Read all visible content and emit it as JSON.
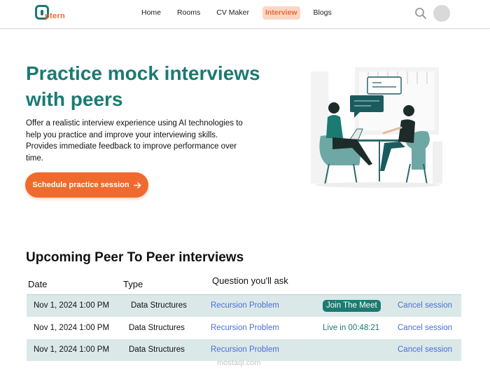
{
  "brand": {
    "name": "ptern"
  },
  "nav": {
    "items": [
      {
        "label": "Home",
        "active": false
      },
      {
        "label": "Rooms",
        "active": false
      },
      {
        "label": "CV Maker",
        "active": false
      },
      {
        "label": "Interview",
        "active": true
      },
      {
        "label": "Blogs",
        "active": false
      }
    ],
    "search_icon": "search-icon",
    "avatar": "avatar"
  },
  "hero": {
    "title": "Practice mock interviews with peers",
    "description": "Offer a realistic interview experience using AI technologies to help you practice and improve your interviewing skills. Provides immediate feedback to improve performance over time.",
    "cta_label": "Schedule practice session",
    "cta_icon": "arrow-right-icon"
  },
  "section": {
    "title": "Upcoming Peer To Peer interviews",
    "columns": [
      "Date",
      "Type",
      "Question you'll ask"
    ]
  },
  "rows": [
    {
      "date": "Nov 1, 2024 1:00 PM",
      "type": "Data Structures",
      "question": "Recursion Problem",
      "action": "Join The Meet",
      "cancel": "Cancel session"
    },
    {
      "date": "Nov 1, 2024 1:00 PM",
      "type": "Data Structures",
      "question": "Recursion Problem",
      "status": "Live in 00:48:21",
      "cancel": "Cancel session"
    },
    {
      "date": "Nov 1, 2024 1:00 PM",
      "type": "Data Structures",
      "question": "Recursion Problem",
      "cancel": "Cancel session"
    }
  ],
  "colors": {
    "teal": "#1b7a72",
    "orange": "#f06a2d",
    "link": "#4a6fd8",
    "row_shade": "#dbe8e8"
  },
  "watermark": "mostaql.com"
}
